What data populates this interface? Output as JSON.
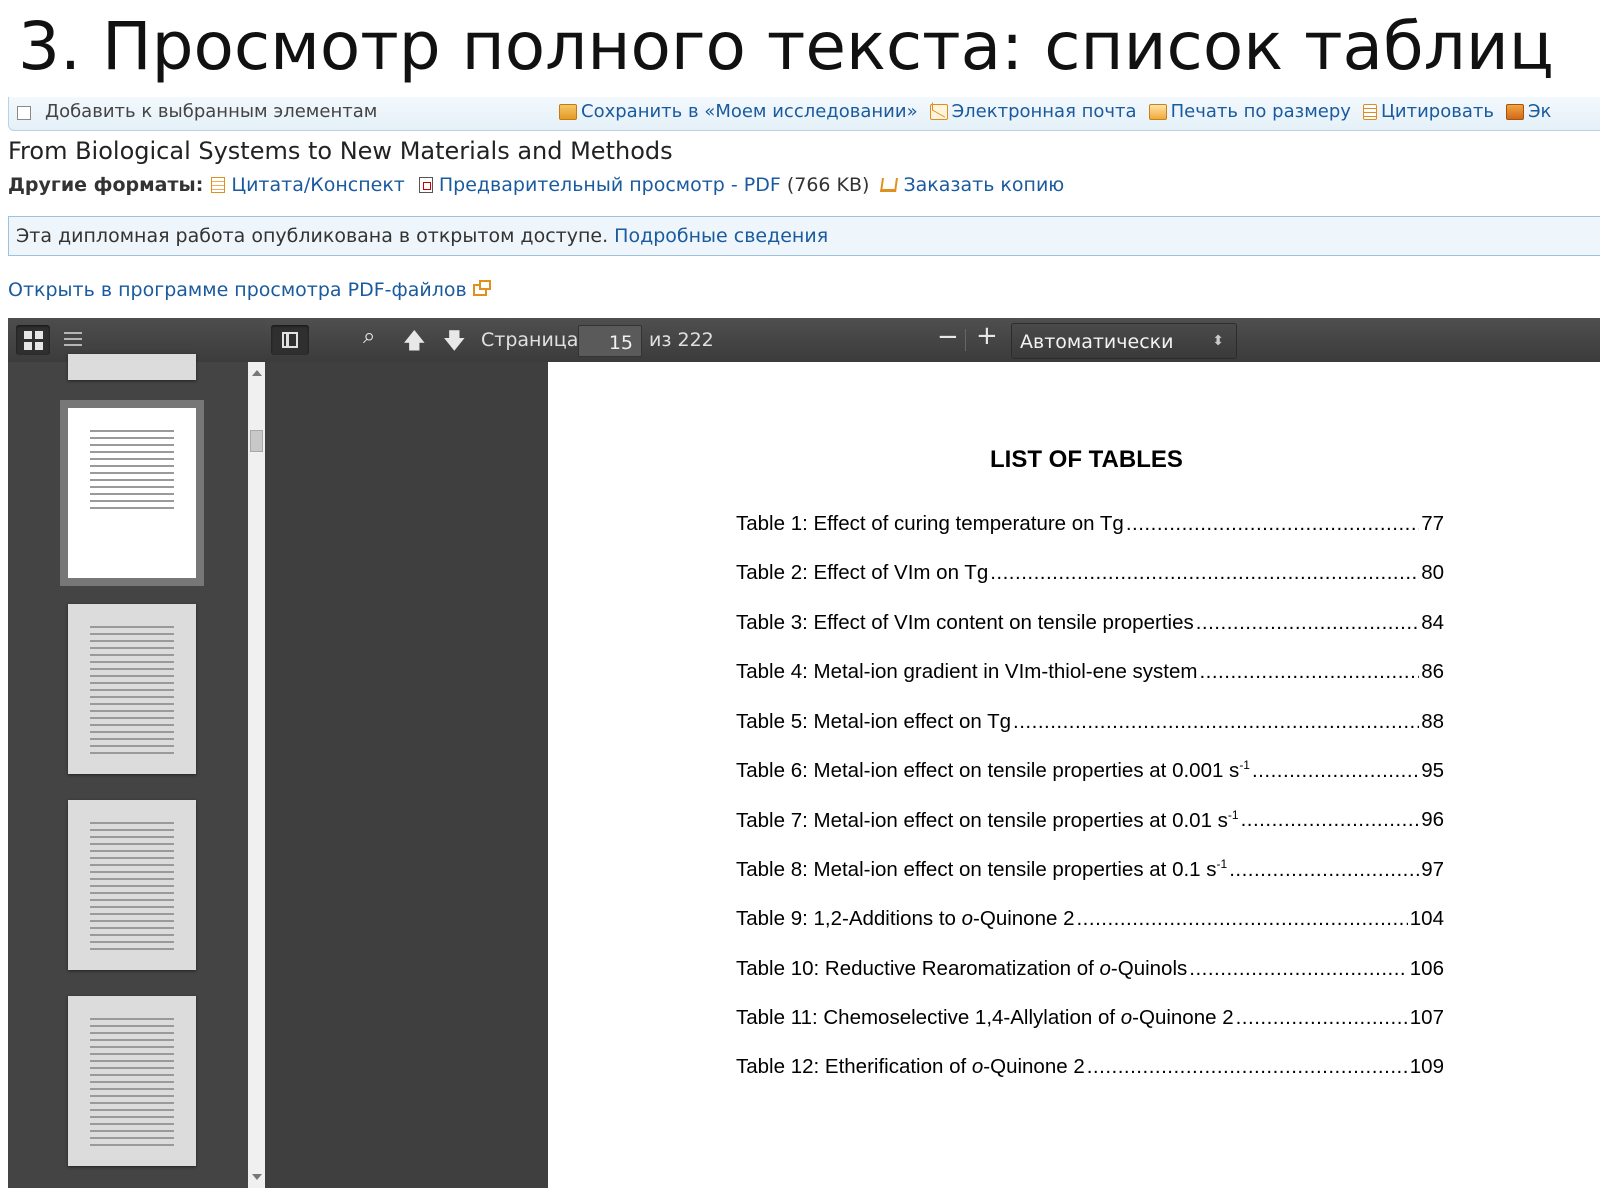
{
  "slide_title": "3. Просмотр полного текста: список таблиц",
  "action_bar": {
    "add_label": "Добавить к выбранным элементам",
    "save": "Сохранить в «Моем исследовании»",
    "email": "Электронная почта",
    "print": "Печать по размеру",
    "cite": "Цитировать",
    "export": "Эк"
  },
  "document": {
    "title": "From Biological Systems to New Materials and Methods",
    "formats_label": "Другие форматы:",
    "format_cite": "Цитата/Конспект",
    "format_pdf": "Предварительный просмотр - PDF",
    "format_pdf_size": "(766 KB)",
    "format_order": "Заказать копию"
  },
  "open_access": {
    "text": "Эта дипломная работа опубликована в открытом доступе.",
    "link": "Подробные сведения"
  },
  "open_viewer_link": "Открыть в программе просмотра PDF-файлов",
  "viewer": {
    "page_label": "Страница:",
    "page_current": "15",
    "page_total": "из 222",
    "zoom_out": "−",
    "zoom_in": "+",
    "zoom_value": "Автоматически"
  },
  "page_content": {
    "heading": "LIST OF TABLES",
    "entries": [
      {
        "label": "Table 1: Effect of curing temperature on Tg",
        "page": "77"
      },
      {
        "label": "Table 2: Effect of VIm on Tg ",
        "page": "80"
      },
      {
        "label": "Table 3: Effect of VIm content on tensile properties",
        "page": "84"
      },
      {
        "label": "Table 4: Metal-ion gradient in VIm-thiol-ene system ",
        "page": "86"
      },
      {
        "label": "Table 5: Metal-ion effect on Tg ",
        "page": "88"
      },
      {
        "label": "Table 6: Metal-ion effect on tensile properties at 0.001 s",
        "sup": "-1",
        "page": "95"
      },
      {
        "label": "Table 7: Metal-ion effect on tensile properties at 0.01 s",
        "sup": "-1",
        "page": "96"
      },
      {
        "label": "Table 8: Metal-ion effect on tensile properties at 0.1 s",
        "sup": "-1",
        "page": "97"
      },
      {
        "label": "Table 9: 1,2-Additions to ",
        "italic": "o",
        "label_rest": "-Quinone 2 ",
        "page": "104"
      },
      {
        "label": "Table 10: Reductive Rearomatization of ",
        "italic": "o",
        "label_rest": "-Quinols",
        "page": "106"
      },
      {
        "label": "Table 11: Chemoselective 1,4-Allylation of ",
        "italic": "o",
        "label_rest": "-Quinone 2 ",
        "page": "107"
      },
      {
        "label": "Table 12: Etherification of ",
        "italic": "o",
        "label_rest": "-Quinone 2",
        "page": "109"
      }
    ]
  },
  "icons": {
    "save": "save-icon",
    "email": "email-icon",
    "print": "print-icon",
    "cite": "cite-icon",
    "export": "export-icon"
  }
}
